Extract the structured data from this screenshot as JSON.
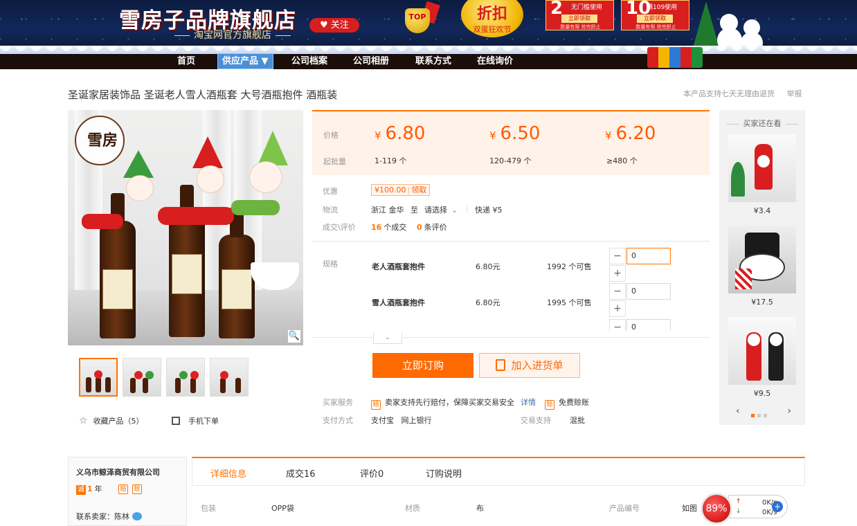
{
  "banner": {
    "brand": "雪房子品牌旗舰店",
    "subtitle": "淘宝网官方旗舰店",
    "follow": "关注",
    "top_badge": "TOP",
    "coin_big": "折扣",
    "coin_small": "双蛋狂欢节",
    "coupon1": {
      "amount": "2",
      "cond": "无门槛使用",
      "get": "立即领取",
      "note": "数量有限 抢完即止"
    },
    "coupon2": {
      "amount": "10",
      "cond": "满109使用",
      "get": "立即领取",
      "note": "数量有限 抢完即止"
    }
  },
  "nav": [
    "首页",
    "供应产品 ▼",
    "公司档案",
    "公司相册",
    "联系方式",
    "在线询价"
  ],
  "product": {
    "title": "圣诞家居装饰品 圣诞老人雪人酒瓶套 大号酒瓶抱件 酒瓶装",
    "seven_days": "本产品支持七天无理由退货",
    "report": "举报",
    "zoom_icon": "🔍",
    "collect": "收藏产品（5）",
    "mobile_order": "手机下单"
  },
  "price": {
    "label": "价格",
    "moq_label": "起批量",
    "tiers": [
      {
        "price": "6.80",
        "qty": "1-119 个"
      },
      {
        "price": "6.50",
        "qty": "120-479 个"
      },
      {
        "price": "6.20",
        "qty": "≥480 个"
      }
    ],
    "currency": "¥"
  },
  "promo": {
    "label": "优惠",
    "amount": "¥100.00",
    "claim": "领取"
  },
  "logistics": {
    "label": "物流",
    "from": "浙江 金华",
    "to": "至",
    "select": "请选择",
    "express": "快递 ¥5"
  },
  "deals": {
    "label": "成交\\评价",
    "deal_count": "16",
    "deal_text": "个成交",
    "review_count": "0",
    "review_text": "条评价"
  },
  "specs": {
    "label": "规格",
    "rows": [
      {
        "name": "老人酒瓶套抱件",
        "price": "6.80元",
        "stock": "1992 个可售",
        "qty": "0"
      },
      {
        "name": "雪人酒瓶套抱件",
        "price": "6.80元",
        "stock": "1995 个可售",
        "qty": "0"
      },
      {
        "name": "",
        "price": "",
        "stock": "",
        "qty": "0"
      }
    ]
  },
  "actions": {
    "order": "立即订购",
    "cart": "加入进货单"
  },
  "service": {
    "label": "买家服务",
    "text1": "卖家支持先行赔付，保障买家交易安全",
    "details": "详情",
    "text2": "免费赊账",
    "pay_label": "支付方式",
    "pay_methods": "支付宝   网上银行",
    "trade_label": "交易支持",
    "trade_value": "混批"
  },
  "recommend": {
    "title": "买家还在看",
    "items": [
      {
        "price": "¥3.4"
      },
      {
        "price": "¥17.5"
      },
      {
        "price": "¥9.5"
      }
    ]
  },
  "company": {
    "name": "义乌市鲸泽商贸有限公司",
    "cheng": "诚",
    "years": "1",
    "years_unit": "年",
    "contact": "联系卖家：陈林"
  },
  "tabs": [
    "详细信息",
    "成交16",
    "评价0",
    "订购说明"
  ],
  "details": [
    {
      "k": "包装",
      "v": "OPP袋"
    },
    {
      "k": "材质",
      "v": "布"
    },
    {
      "k": "产品编号",
      "v": "如图"
    }
  ],
  "net": {
    "percent": "89%",
    "up": "0K/s",
    "down": "0K/s"
  }
}
